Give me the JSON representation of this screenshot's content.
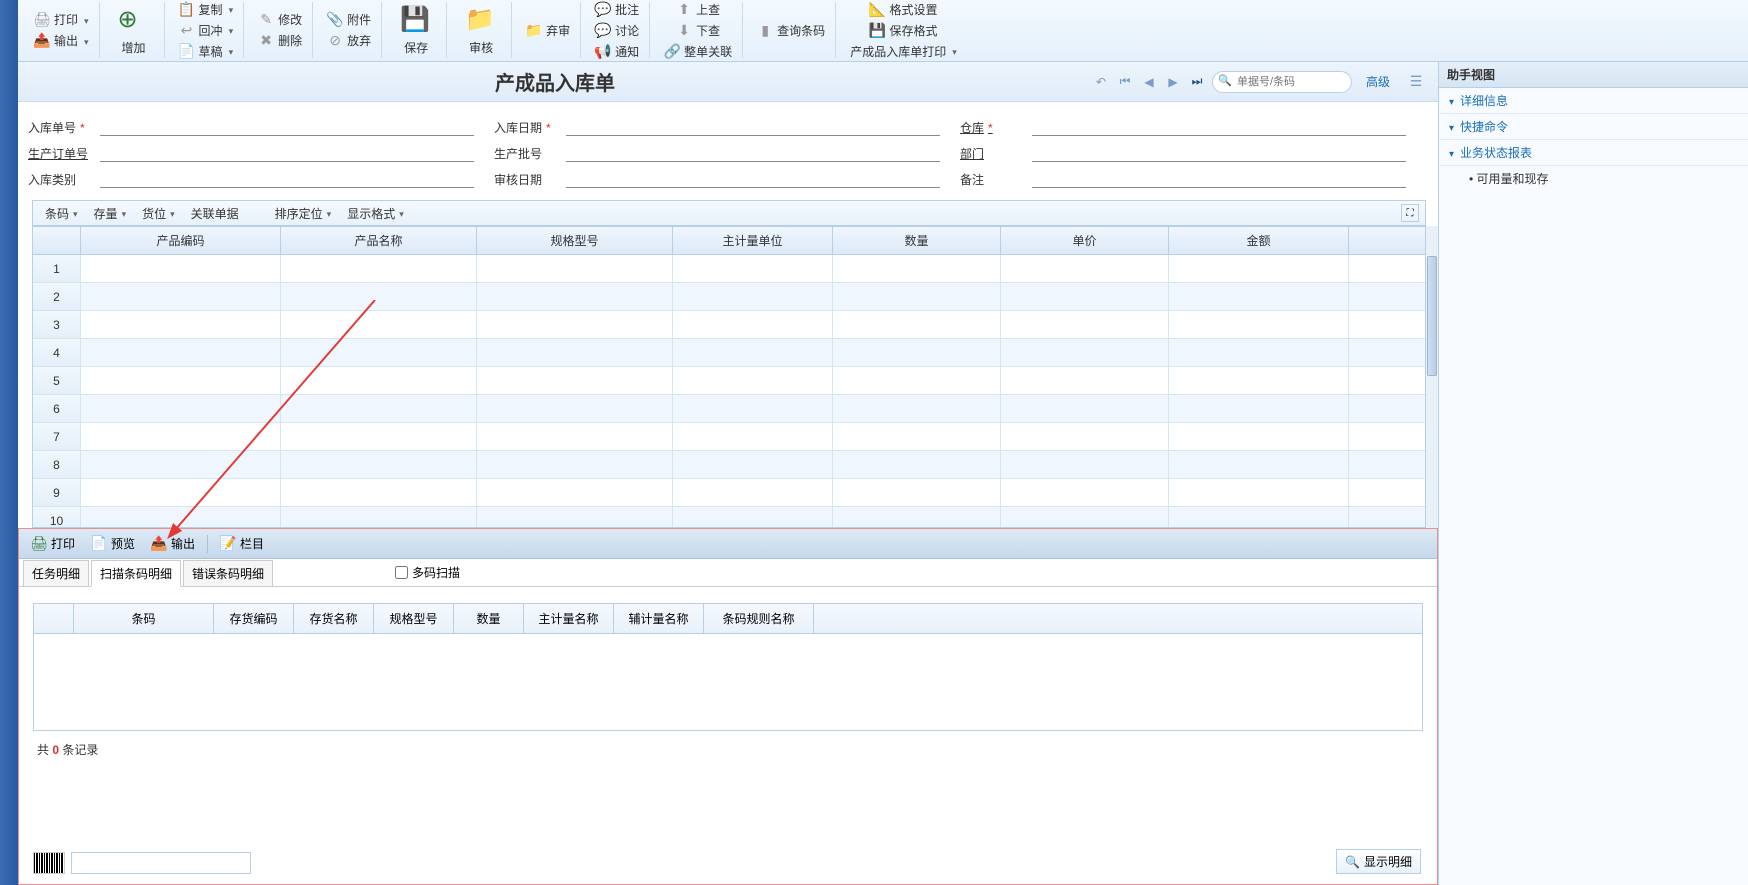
{
  "ribbon": {
    "print": "打印",
    "export": "输出",
    "add": "增加",
    "copy": "复制",
    "revert": "回冲",
    "draft": "草稿",
    "modify": "修改",
    "delete": "删除",
    "attach": "附件",
    "abandon": "放弃",
    "save": "保存",
    "review": "审核",
    "reject": "弃审",
    "approve": "批注",
    "discuss": "讨论",
    "notify": "通知",
    "submit": "上查",
    "lookdown": "下查",
    "relate": "整单关联",
    "qrybarcode": "查询条码",
    "fmt": "格式设置",
    "savefmt": "保存格式",
    "printname": "产成品入库单打印"
  },
  "doc": {
    "title": "产成品入库单",
    "searchPlaceholder": "单据号/条码",
    "advanced": "高级"
  },
  "form": {
    "r1": {
      "l1": "入库单号",
      "l2": "入库日期",
      "l3": "仓库"
    },
    "r2": {
      "l1": "生产订单号",
      "l2": "生产批号",
      "l3": "部门"
    },
    "r3": {
      "l1": "入库类别",
      "l2": "审核日期",
      "l3": "备注"
    }
  },
  "gridToolbar": {
    "barcode": "条码",
    "stock": "存量",
    "loc": "货位",
    "reldoc": "关联单据",
    "sort": "排序定位",
    "dispfmt": "显示格式"
  },
  "gridCols": [
    "产品编码",
    "产品名称",
    "规格型号",
    "主计量单位",
    "数量",
    "单价",
    "金额"
  ],
  "gridRows": [
    1,
    2,
    3,
    4,
    5,
    6,
    7,
    8,
    9,
    10
  ],
  "subToolbar": {
    "print": "打印",
    "preview": "预览",
    "export": "输出",
    "cols": "栏目"
  },
  "subTabs": [
    "任务明细",
    "扫描条码明细",
    "错误条码明细"
  ],
  "multiScan": "多码扫描",
  "subGridCols": [
    "条码",
    "存货编码",
    "存货名称",
    "规格型号",
    "数量",
    "主计量名称",
    "辅计量名称",
    "条码规则名称"
  ],
  "subFooter": {
    "pre": "共",
    "zero": "0",
    "post": "条记录"
  },
  "showDetail": "显示明细",
  "rightPanel": {
    "title": "助手视图",
    "items": [
      "详细信息",
      "快捷命令",
      "业务状态报表"
    ],
    "sub": "可用量和现存"
  }
}
